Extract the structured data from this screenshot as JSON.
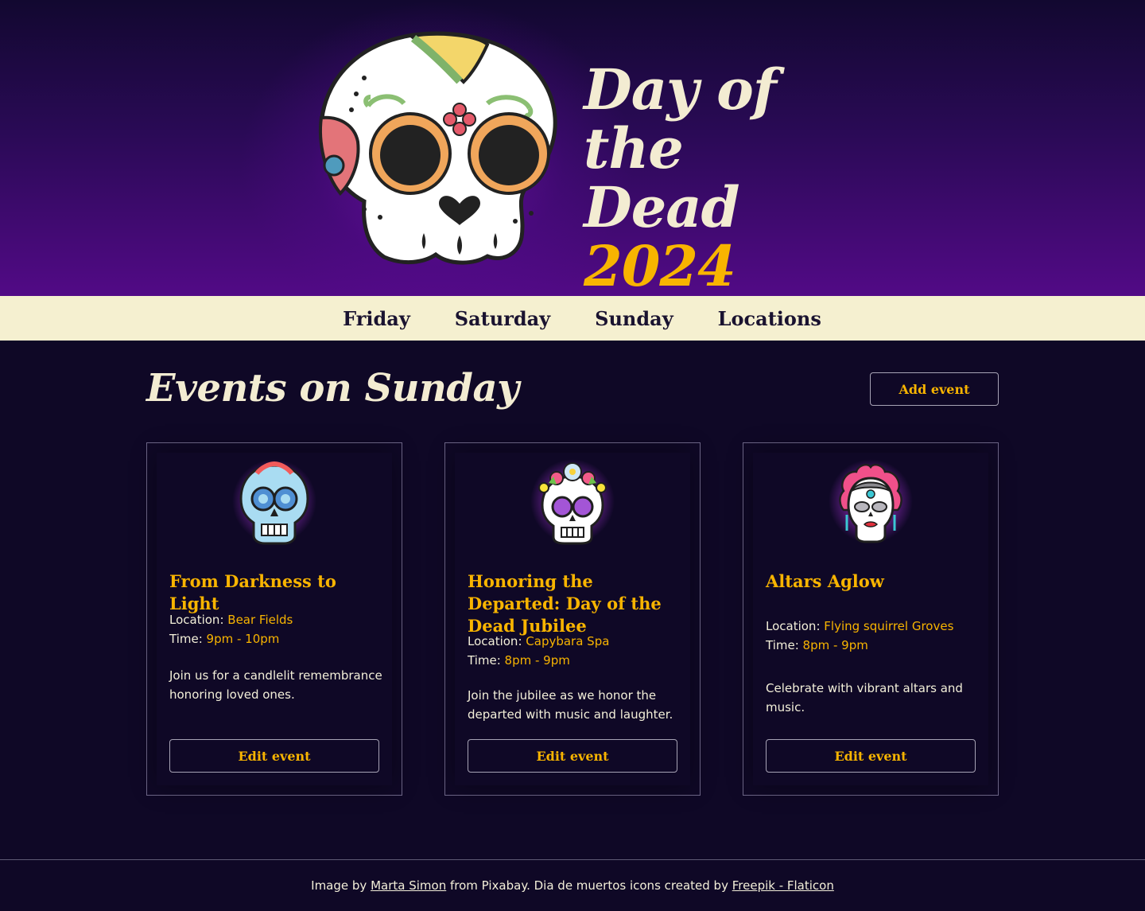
{
  "hero": {
    "title_line1": "Day of",
    "title_line2": "the Dead",
    "year": "2024",
    "skull_icon": "sugar-skull-icon"
  },
  "nav": {
    "items": [
      {
        "label": "Friday"
      },
      {
        "label": "Saturday"
      },
      {
        "label": "Sunday"
      },
      {
        "label": "Locations"
      }
    ]
  },
  "main": {
    "heading": "Events on Sunday",
    "add_button": "Add event"
  },
  "events": [
    {
      "icon": "blue-sugar-skull-icon",
      "title": "From Darkness to Light",
      "location_label": "Location:",
      "location": "Bear Fields",
      "time_label": "Time:",
      "time": "9pm - 10pm",
      "description": "Join us for a candlelit remembrance honoring loved ones.",
      "edit_button": "Edit event"
    },
    {
      "icon": "flower-crown-skull-icon",
      "title": "Honoring the Departed: Day of the Dead Jubilee",
      "location_label": "Location:",
      "location": "Capybara Spa",
      "time_label": "Time:",
      "time": "8pm - 9pm",
      "description": "Join the jubilee as we honor the departed with music and laughter.",
      "edit_button": "Edit event"
    },
    {
      "icon": "catrina-skull-icon",
      "title": "Altars Aglow",
      "location_label": "Location:",
      "location": "Flying squirrel Groves",
      "time_label": "Time:",
      "time": "8pm - 9pm",
      "description": "Celebrate with vibrant altars and music.",
      "edit_button": "Edit event"
    }
  ],
  "footer": {
    "prefix": "Image by",
    "author_link": "Marta Simon",
    "middle": "from Pixabay. Dia de muertos icons created by",
    "icons_link": "Freepik - Flaticon"
  },
  "colors": {
    "background": "#0f0826",
    "accent": "#f8b400",
    "cream": "#f5f0d0",
    "hero_purple": "#520a86"
  }
}
